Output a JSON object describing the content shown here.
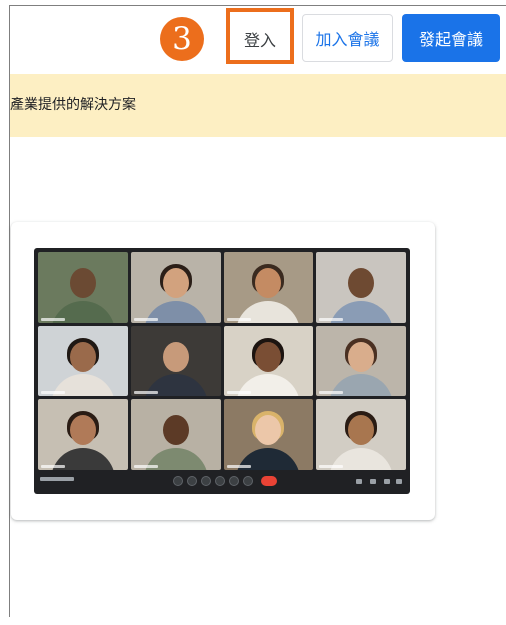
{
  "step": {
    "number": "3",
    "color": "#ec6e1c"
  },
  "header": {
    "sign_in_label": "登入",
    "join_label": "加入會議",
    "start_label": "發起會議",
    "accent_color": "#1a73e8"
  },
  "banner": {
    "text": "產業提供的解決方案",
    "background": "#fdefc3"
  },
  "preview": {
    "image_description_icon": "video-conference-image",
    "participant_count": 12,
    "controls": [
      "mic-icon",
      "camera-icon",
      "captions-icon",
      "raise-hand-icon",
      "present-icon",
      "more-icon",
      "hangup-icon"
    ]
  }
}
